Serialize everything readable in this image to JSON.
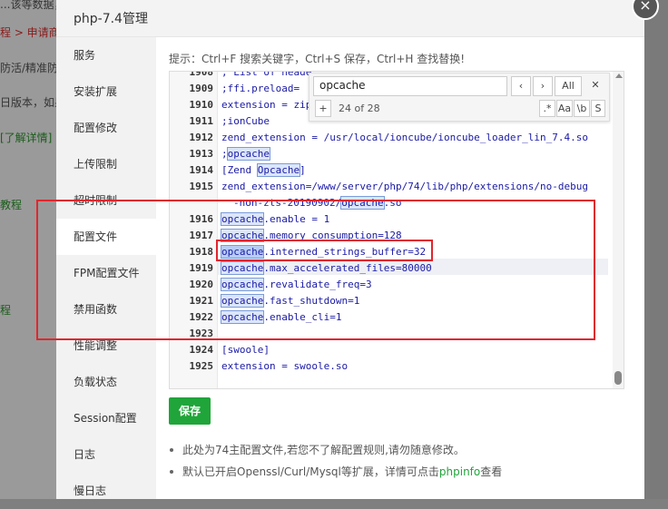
{
  "background": {
    "lines": [
      {
        "text": "...该等数据，"
      },
      {
        "text": "程 > 申请商业",
        "color": "red"
      },
      {
        "text": "防活/精准防护"
      },
      {
        "text": "日版本，如果"
      },
      {
        "text": "[了解详情]",
        "color": "green"
      },
      {
        "text": "教程",
        "color": "green"
      },
      {
        "text": "程",
        "color": "green"
      }
    ]
  },
  "dialog": {
    "title": "php-7.4管理",
    "close_glyph": "×"
  },
  "sidebar": {
    "items": [
      {
        "label": "服务"
      },
      {
        "label": "安装扩展"
      },
      {
        "label": "配置修改"
      },
      {
        "label": "上传限制"
      },
      {
        "label": "超时限制"
      },
      {
        "label": "配置文件",
        "active": true
      },
      {
        "label": "FPM配置文件"
      },
      {
        "label": "禁用函数"
      },
      {
        "label": "性能调整"
      },
      {
        "label": "负载状态"
      },
      {
        "label": "Session配置"
      },
      {
        "label": "日志"
      },
      {
        "label": "慢日志"
      }
    ]
  },
  "tip": "提示：Ctrl+F 搜索关键字，Ctrl+S 保存，Ctrl+H 查找替换!",
  "find": {
    "query": "opcache",
    "prev_glyph": "‹",
    "next_glyph": "›",
    "all_label": "All",
    "close_glyph": "✕",
    "replace_toggle": "+",
    "count": "24 of 28",
    "opt_regex": ".*",
    "opt_case": "Aa",
    "opt_word": "\\b",
    "opt_selection": "S"
  },
  "editor": {
    "lines": [
      {
        "n": "1908",
        "text": "; List of heade"
      },
      {
        "n": "1909",
        "text": ";ffi.preload="
      },
      {
        "n": "1910",
        "text": "extension = zip.so"
      },
      {
        "n": "1911",
        "text": ";ionCube"
      },
      {
        "n": "1912",
        "text": "zend_extension = /usr/local/ioncube/ioncube_loader_lin_7.4.so"
      },
      {
        "n": "1913",
        "text": ";opcache"
      },
      {
        "n": "1914",
        "text": "[Zend Opcache]"
      },
      {
        "n": "1915",
        "text": "zend_extension=/www/server/php/74/lib/php/extensions/no-debug"
      },
      {
        "n": "",
        "text": "-non-zts-20190902/opcache.so"
      },
      {
        "n": "1916",
        "text": "opcache.enable = 1"
      },
      {
        "n": "1917",
        "text": "opcache.memory_consumption=128"
      },
      {
        "n": "1918",
        "text": "opcache.interned_strings_buffer=32"
      },
      {
        "n": "1919",
        "text": "opcache.max_accelerated_files=80000"
      },
      {
        "n": "1920",
        "text": "opcache.revalidate_freq=3"
      },
      {
        "n": "1921",
        "text": "opcache.fast_shutdown=1"
      },
      {
        "n": "1922",
        "text": "opcache.enable_cli=1"
      },
      {
        "n": "1923",
        "text": ""
      },
      {
        "n": "1924",
        "text": "[swoole]"
      },
      {
        "n": "1925",
        "text": "extension = swoole.so"
      }
    ]
  },
  "save_label": "保存",
  "notes": {
    "note1": "此处为74主配置文件,若您不了解配置规则,请勿随意修改。",
    "note2_prefix": "默认已开启Openssl/Curl/Mysql等扩展，详情可点击",
    "note2_link": "phpinfo",
    "note2_suffix": "查看"
  },
  "colors": {
    "accent": "#20a53a",
    "annotation_red": "#e0262e",
    "code_blue": "#1a1aa6"
  }
}
